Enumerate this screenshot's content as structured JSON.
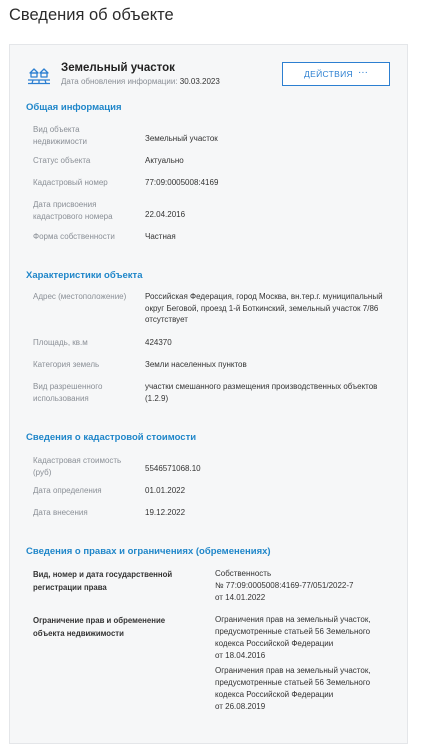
{
  "page": {
    "title": "Сведения об объекте"
  },
  "object": {
    "title": "Земельный участок",
    "updated_label": "Дата обновления информации:",
    "updated_date": "30.03.2023",
    "actions_label": "ДЕЙСТВИЯ",
    "actions_dots": "···",
    "icon": "land-plot-icon"
  },
  "sections": {
    "general": {
      "title": "Общая информация",
      "rows": [
        {
          "label": "Вид объекта недвижимости",
          "value": "Земельный участок"
        },
        {
          "label": "Статус объекта",
          "value": "Актуально"
        },
        {
          "label": "Кадастровый номер",
          "value": "77:09:0005008:4169"
        },
        {
          "label": "Дата присвоения кадастрового номера",
          "value": "22.04.2016"
        },
        {
          "label": "Форма собственности",
          "value": "Частная"
        }
      ]
    },
    "characteristics": {
      "title": "Характеристики объекта",
      "rows": [
        {
          "label": "Адрес (местоположение)",
          "value": "Российская Федерация, город Москва, вн.тер.г. муниципальный округ Беговой, проезд 1-й Боткинский, земельный участок 7/86 отсутствует"
        },
        {
          "label": "Площадь, кв.м",
          "value": "424370"
        },
        {
          "label": "Категория земель",
          "value": "Земли населенных пунктов"
        },
        {
          "label": "Вид разрешенного использования",
          "value": "участки смешанного размещения производственных объектов (1.2.9)"
        }
      ]
    },
    "cadastral_value": {
      "title": "Сведения о кадастровой стоимости",
      "rows": [
        {
          "label": "Кадастровая стоимость (руб)",
          "value": "5546571068.10"
        },
        {
          "label": "Дата определения",
          "value": "01.01.2022"
        },
        {
          "label": "Дата внесения",
          "value": "19.12.2022"
        }
      ]
    },
    "rights": {
      "title": "Сведения о правах и ограничениях (обременениях)",
      "rows": [
        {
          "label": "Вид, номер и дата государственной регистрации права",
          "values": [
            "Собственность",
            "№ 77:09:0005008:4169-77/051/2022-7",
            "от 14.01.2022"
          ]
        },
        {
          "label": "Ограничение прав и обременение объекта недвижимости",
          "values": [
            "Ограничения прав на земельный участок, предусмотренные статьей 56 Земельного кодекса Российской Федерации",
            "от 18.04.2016"
          ]
        },
        {
          "label": "",
          "values": [
            "Ограничения прав на земельный участок, предусмотренные статьей 56 Земельного кодекса Российской Федерации",
            "от 26.08.2019"
          ]
        }
      ]
    }
  },
  "colors": {
    "accent": "#1f86c9",
    "button": "#2c7fd1",
    "muted": "#8a8f96",
    "card_bg": "#f6f7f8"
  }
}
